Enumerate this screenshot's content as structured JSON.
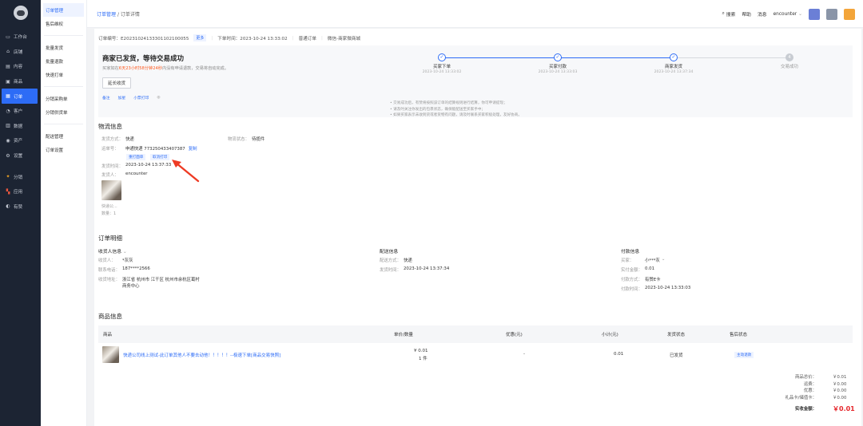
{
  "sidebar": {
    "items": [
      {
        "label": "工作台",
        "icon": "monitor-icon"
      },
      {
        "label": "店铺",
        "icon": "store-icon"
      },
      {
        "label": "内容",
        "icon": "content-icon"
      },
      {
        "label": "商品",
        "icon": "goods-icon"
      },
      {
        "label": "订单",
        "icon": "order-icon",
        "active": true
      },
      {
        "label": "客户",
        "icon": "user-icon"
      },
      {
        "label": "数据",
        "icon": "chart-icon"
      },
      {
        "label": "资产",
        "icon": "wallet-icon"
      },
      {
        "label": "设置",
        "icon": "gear-icon"
      },
      {
        "label": "分销",
        "icon": "share-icon"
      },
      {
        "label": "应用",
        "icon": "apps-icon"
      },
      {
        "label": "有赞",
        "icon": "youzan-icon"
      }
    ]
  },
  "subbar": {
    "items": [
      "订单管理",
      "售后维权",
      "批量发货",
      "批量退款",
      "快速打单",
      "分销采购单",
      "分销供货单",
      "配送管理",
      "订单设置"
    ]
  },
  "topbar": {
    "crumb_root": "订单管理",
    "crumb_sep": "/",
    "crumb_current": "订单详情",
    "search": "搜索",
    "help": "帮助",
    "messages": "消息",
    "user": "encounter"
  },
  "order": {
    "no_label": "订单编号：",
    "no_value": "E20231024133301102100055",
    "more": "更多",
    "time_label": "下单时间：",
    "time_value": "2023-10-24 13:33:02",
    "type": "普通订单",
    "channel": "微信-商家微商城"
  },
  "status": {
    "title": "商家已发货，等待交易成功",
    "sub_prefix": "买家如在",
    "sub_highlight": "6天23小时58分钟24秒",
    "sub_suffix": "内没有申请退款，交易将自动完成。",
    "confirm_button": "延长收货",
    "actions": [
      "备注",
      "加星",
      "小票打印"
    ]
  },
  "steps": [
    {
      "label": "买家下单",
      "time": "2023-10-24 13:33:02",
      "done": true
    },
    {
      "label": "买家付款",
      "time": "2023-10-24 13:33:03",
      "done": true
    },
    {
      "label": "商家发货",
      "time": "2023-10-24 13:37:34",
      "done": true
    },
    {
      "label": "交易成功",
      "time": "",
      "done": false,
      "num": "4"
    }
  ],
  "notes": [
    "交易成功后，有赞将按照该订单的结算规则进行结算，你可申请提现；",
    "请及时关注你发出的包裹状态，确保能配送至买家手中；",
    "如果买家表示未收到货或者货物有问题，请及时联系买家积极处理，友好协商。"
  ],
  "logistics": {
    "title": "物流信息",
    "method_label": "发货方式：",
    "method_value": "快递",
    "status_label": "物流状态：",
    "status_value": "待揽件",
    "tracking_label": "运单号：",
    "tracking_value": "申通快递 773250433407387",
    "copy": "复制",
    "reprint": "重打面单",
    "cancel_print": "取消打印",
    "ship_time_label": "发货时间：",
    "ship_time_value": "2023-10-24 13:37:33",
    "sender_label": "发货人：",
    "sender_value": "encounter",
    "item_name": "快递公...",
    "qty": "数量：1"
  },
  "detail": {
    "title": "订单明细",
    "receiver": {
      "title": "收货人信息",
      "name_label": "收货人：",
      "name_value": "*灰灰",
      "phone_label": "联系电话：",
      "phone_value": "187****2566",
      "addr_label": "收货地址：",
      "addr_line1": "浙江省 杭州市 江干区 杭州市余杭区葛村",
      "addr_line2": "商务中心"
    },
    "delivery": {
      "title": "配送信息",
      "method_label": "配送方式：",
      "method_value": "快递",
      "time_label": "发货时间：",
      "time_value": "2023-10-24 13:37:34"
    },
    "payment": {
      "title": "付款信息",
      "buyer_label": "买家：",
      "buyer_value": "小***灰",
      "paid_label": "实付金额：",
      "paid_value": "0.01",
      "method_label": "付款方式：",
      "method_value": "有赞E卡",
      "time_label": "付款时间：",
      "time_value": "2023-10-24 13:33:03"
    }
  },
  "goods": {
    "title": "商品信息",
    "headers": [
      "商品",
      "单价/数量",
      "优惠(元)",
      "小计(元)",
      "发货状态",
      "售后状态"
    ],
    "row": {
      "name": "快递公司线上测试-此订单其他人不要去动他！！！！！--极速下单[商品交易快照]",
      "price": "¥ 0.01",
      "qty": "1 件",
      "discount": "-",
      "subtotal": "0.01",
      "ship_status": "已发货",
      "after_sale": "主动退款"
    }
  },
  "summary": {
    "rows": [
      {
        "k": "商品总价：",
        "v": "￥0.01"
      },
      {
        "k": "运费：",
        "v": "￥0.00"
      },
      {
        "k": "优惠：",
        "v": "￥0.00"
      },
      {
        "k": "礼品卡/储值卡：",
        "v": "￥0.00"
      }
    ],
    "total_label": "实收金额：",
    "total_value": "￥0.01"
  },
  "colors": {
    "accent": "#2d6cf6",
    "sidebar": "#1c2433",
    "highlight": "#ff5a1f",
    "total": "#e5252a",
    "arrow": "#ee3b24"
  }
}
